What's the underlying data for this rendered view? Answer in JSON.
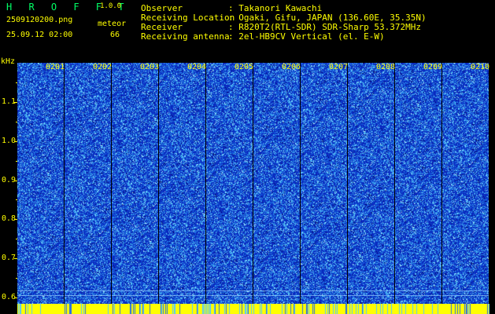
{
  "app": {
    "logo": "H R O F F T",
    "version": "1.0.0"
  },
  "file": {
    "name": "2509120200.png",
    "datetime": "25.09.12 02:00"
  },
  "detection": {
    "label": "meteor",
    "count": "66"
  },
  "station": {
    "labels": [
      "Observer",
      "Receiving Location",
      "Receiver",
      "Receiving antenna"
    ],
    "values": [
      ": Takanori Kawachi",
      ": Ogaki, Gifu, JAPAN (136.60E, 35.35N)",
      ": R820T2(RTL-SDR) SDR-Sharp 53.372MHz",
      ": 2el-HB9CV Vertical (el. E-W)"
    ]
  },
  "axis": {
    "unit": "kHz",
    "freq_labels": [
      "1.1",
      "1.0",
      "0.9",
      "0.8",
      "0.7",
      "0.6"
    ],
    "time_labels": [
      "0201",
      "0202",
      "0203",
      "0204",
      "0205",
      "0206",
      "0207",
      "0208",
      "0209",
      "0210"
    ]
  },
  "colors": {
    "background": "#000000",
    "text": "#ffff00",
    "logo": "#00ff66",
    "spectrogram_base": "#103cc8",
    "speckle": "#6fd0ff",
    "band": "#ffff00"
  }
}
